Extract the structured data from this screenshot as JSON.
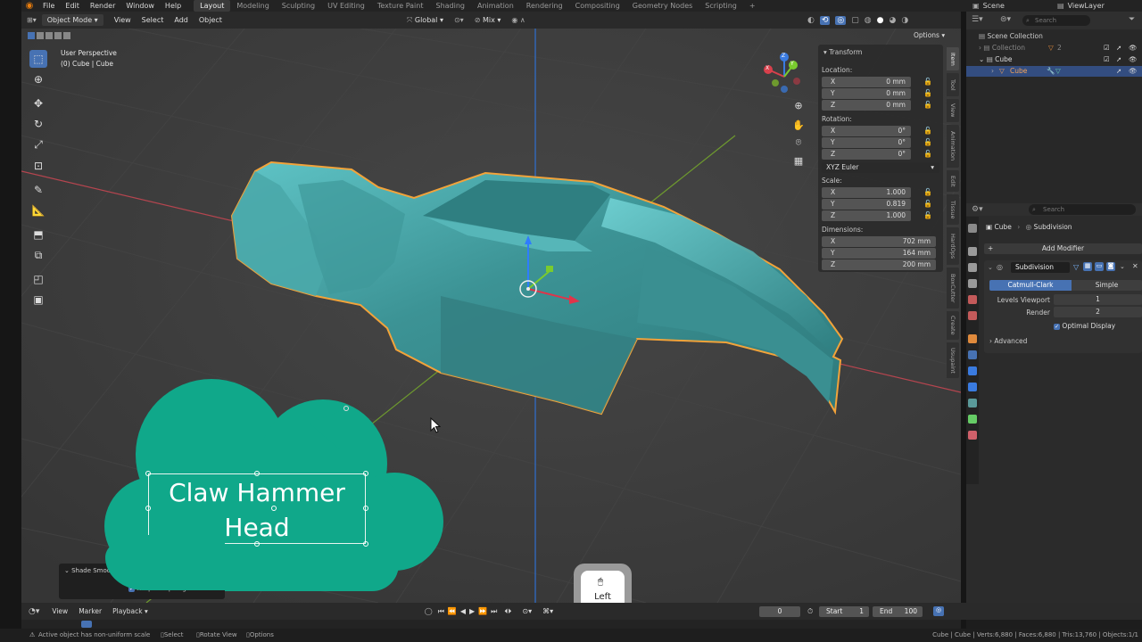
{
  "app": {
    "name": "Blender"
  },
  "topbar": {
    "menus": [
      "File",
      "Edit",
      "Render",
      "Window",
      "Help"
    ],
    "workspaces": [
      "Layout",
      "Modeling",
      "Sculpting",
      "UV Editing",
      "Texture Paint",
      "Shading",
      "Animation",
      "Rendering",
      "Compositing",
      "Geometry Nodes",
      "Scripting"
    ],
    "active_workspace": "Layout",
    "add_tab": "+",
    "scene": "Scene",
    "view_layer": "ViewLayer"
  },
  "viewport_header": {
    "mode": "Object Mode",
    "menus": [
      "View",
      "Select",
      "Add",
      "Object"
    ],
    "orientation": "Global",
    "snap": "Mix",
    "options": "Options"
  },
  "viewport": {
    "perspective": "User Perspective",
    "object_info": "(0) Cube | Cube",
    "gizmo_axes": [
      "X",
      "Y",
      "Z"
    ]
  },
  "npanel": {
    "title": "Transform",
    "location_label": "Location:",
    "location": [
      {
        "k": "X",
        "v": "0 mm"
      },
      {
        "k": "Y",
        "v": "0 mm"
      },
      {
        "k": "Z",
        "v": "0 mm"
      }
    ],
    "rotation_label": "Rotation:",
    "rotation": [
      {
        "k": "X",
        "v": "0°"
      },
      {
        "k": "Y",
        "v": "0°"
      },
      {
        "k": "Z",
        "v": "0°"
      }
    ],
    "rotation_mode": "XYZ Euler",
    "scale_label": "Scale:",
    "scale": [
      {
        "k": "X",
        "v": "1.000"
      },
      {
        "k": "Y",
        "v": "0.819"
      },
      {
        "k": "Z",
        "v": "1.000"
      }
    ],
    "dimensions_label": "Dimensions:",
    "dimensions": [
      {
        "k": "X",
        "v": "702 mm"
      },
      {
        "k": "Y",
        "v": "164 mm"
      },
      {
        "k": "Z",
        "v": "200 mm"
      }
    ]
  },
  "npanel_tabs": [
    "Item",
    "Tool",
    "View",
    "Animation",
    "Edit",
    "Tissue",
    "HardOps",
    "BoxCutter",
    "Create",
    "Usupaint"
  ],
  "outliner": {
    "search_placeholder": "Search",
    "root": "Scene Collection",
    "collection": "Collection",
    "collection_count": "2",
    "object": "Cube",
    "mesh": "Cube"
  },
  "properties": {
    "search_placeholder": "Search",
    "breadcrumb_object": "Cube",
    "breadcrumb_modifier": "Subdivision",
    "add_modifier": "Add Modifier",
    "modifier_name": "Subdivision",
    "mode_options": [
      "Catmull-Clark",
      "Simple"
    ],
    "mode_active": "Catmull-Clark",
    "levels_viewport_label": "Levels Viewport",
    "levels_viewport": "1",
    "render_label": "Render",
    "render": "2",
    "optimal_display": "Optimal Display",
    "advanced": "Advanced"
  },
  "overlay": {
    "callout": "Claw Hammer\nHead",
    "key_label": "Left",
    "shade_panel_title": "Shade Smooth",
    "shade_panel_option": "Keep Sharp Edges"
  },
  "timeline": {
    "menus": [
      "View",
      "Marker",
      "Playback"
    ],
    "current_frame": "0",
    "start_label": "Start",
    "start": "1",
    "end_label": "End",
    "end": "100"
  },
  "statusbar": {
    "warning": "Active object has non-uniform scale",
    "select": "Select",
    "rotate_view": "Rotate View",
    "options": "Options",
    "stats": "Cube | Cube | Verts:6,880 | Faces:6,880 | Tris:13,760 | Objects:1/1"
  },
  "colors": {
    "accent": "#4772b3",
    "mesh": "#3f9a9d",
    "callout": "#10a88a",
    "selection": "#f2a33a"
  }
}
